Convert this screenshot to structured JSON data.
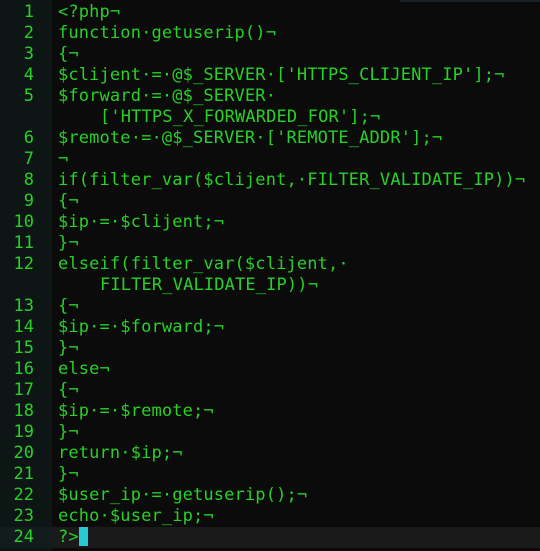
{
  "editor": {
    "colors": {
      "text": "#27d127",
      "background": "#0b0b0b",
      "gutter": "#0d1515",
      "cursor": "#27c9d6"
    },
    "current_line": 24,
    "lines": [
      {
        "n": "1",
        "rows": [
          "<?php¬"
        ]
      },
      {
        "n": "2",
        "rows": [
          "function·getuserip()¬"
        ]
      },
      {
        "n": "3",
        "rows": [
          "{¬"
        ]
      },
      {
        "n": "4",
        "rows": [
          "$clijent·=·@$_SERVER·['HTTPS_CLIJENT_IP'];¬"
        ]
      },
      {
        "n": "5",
        "rows": [
          "$forward·=·@$_SERVER·",
          "['HTTPS_X_FORWARDED_FOR'];¬"
        ]
      },
      {
        "n": "6",
        "rows": [
          "$remote·=·@$_SERVER·['REMOTE_ADDR'];¬"
        ]
      },
      {
        "n": "7",
        "rows": [
          "¬"
        ]
      },
      {
        "n": "8",
        "rows": [
          "if(filter_var($clijent,·FILTER_VALIDATE_IP))¬"
        ]
      },
      {
        "n": "9",
        "rows": [
          "{¬"
        ]
      },
      {
        "n": "10",
        "rows": [
          "$ip·=·$clijent;¬"
        ]
      },
      {
        "n": "11",
        "rows": [
          "}¬"
        ]
      },
      {
        "n": "12",
        "rows": [
          "elseif(filter_var($clijent,·",
          "FILTER_VALIDATE_IP))¬"
        ]
      },
      {
        "n": "13",
        "rows": [
          "{¬"
        ]
      },
      {
        "n": "14",
        "rows": [
          "$ip·=·$forward;¬"
        ]
      },
      {
        "n": "15",
        "rows": [
          "}¬"
        ]
      },
      {
        "n": "16",
        "rows": [
          "else¬"
        ]
      },
      {
        "n": "17",
        "rows": [
          "{¬"
        ]
      },
      {
        "n": "18",
        "rows": [
          "$ip·=·$remote;¬"
        ]
      },
      {
        "n": "19",
        "rows": [
          "}¬"
        ]
      },
      {
        "n": "20",
        "rows": [
          "return·$ip;¬"
        ]
      },
      {
        "n": "21",
        "rows": [
          "}¬"
        ]
      },
      {
        "n": "22",
        "rows": [
          "$user_ip·=·getuserip();¬"
        ]
      },
      {
        "n": "23",
        "rows": [
          "echo·$user_ip;¬"
        ]
      },
      {
        "n": "24",
        "rows": [
          "?>"
        ]
      }
    ]
  }
}
